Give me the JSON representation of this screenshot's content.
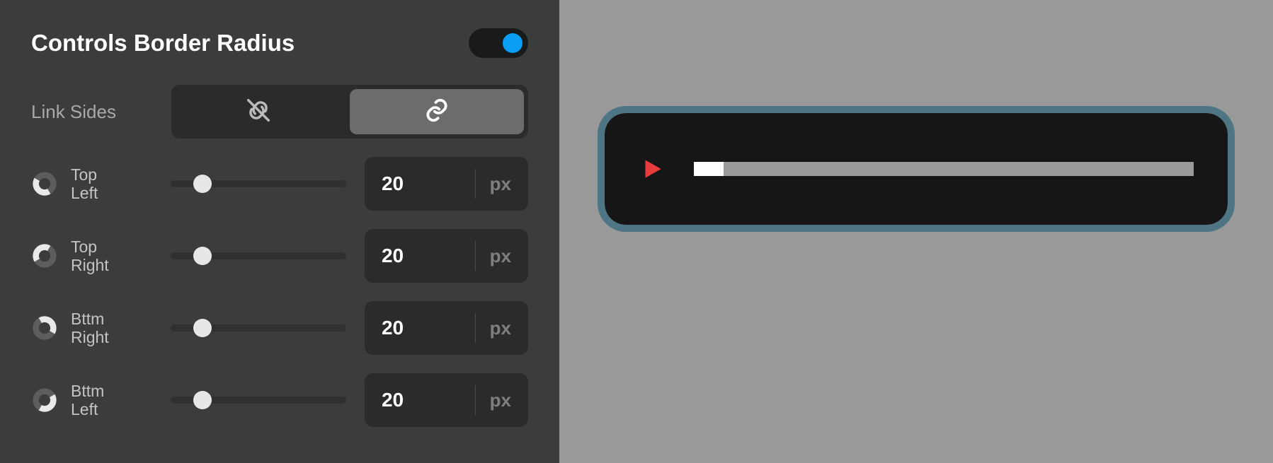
{
  "panel": {
    "title": "Controls Border Radius",
    "toggle_on": true,
    "link_sides_label": "Link Sides",
    "link_mode": "linked",
    "corners": [
      {
        "label_line1": "Top",
        "label_line2": "Left",
        "value": "20",
        "unit": "px",
        "slider_pct": 18,
        "arc_start": 150,
        "arc_end": 300
      },
      {
        "label_line1": "Top",
        "label_line2": "Right",
        "value": "20",
        "unit": "px",
        "slider_pct": 18,
        "arc_start": 240,
        "arc_end": 390
      },
      {
        "label_line1": "Bttm",
        "label_line2": "Right",
        "value": "20",
        "unit": "px",
        "slider_pct": 18,
        "arc_start": 330,
        "arc_end": 480
      },
      {
        "label_line1": "Bttm",
        "label_line2": "Left",
        "value": "20",
        "unit": "px",
        "slider_pct": 18,
        "arc_start": 60,
        "arc_end": 210
      }
    ]
  },
  "preview": {
    "border_radius_px": 30,
    "outline_color": "#4e7583",
    "progress_pct": 6
  }
}
